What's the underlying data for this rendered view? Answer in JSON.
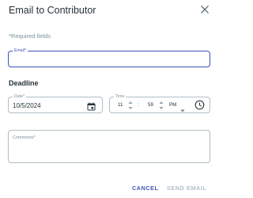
{
  "dialog": {
    "title": "Email to Contributor",
    "required_note": "*Required fields"
  },
  "email": {
    "label": "Email*",
    "value": ""
  },
  "deadline": {
    "heading": "Deadline",
    "date_label": "Date*",
    "date_value": "10/5/2024",
    "time_label": "Time",
    "hour": "11",
    "separator": ":",
    "minute": "59",
    "ampm": "PM"
  },
  "comments": {
    "label": "Comments*",
    "value": ""
  },
  "actions": {
    "cancel_label": "CANCEL",
    "send_label": "SEND EMAIL"
  },
  "icons": {
    "close": "close-icon",
    "calendar": "calendar-icon",
    "clock": "clock-icon",
    "spinner": "up-down-arrows-icon",
    "caret": "caret-down-icon"
  },
  "colors": {
    "accent": "#3f51b5",
    "text": "#263238",
    "muted": "#78909c",
    "border": "#b0bec5",
    "disabled": "#b0bec5"
  }
}
